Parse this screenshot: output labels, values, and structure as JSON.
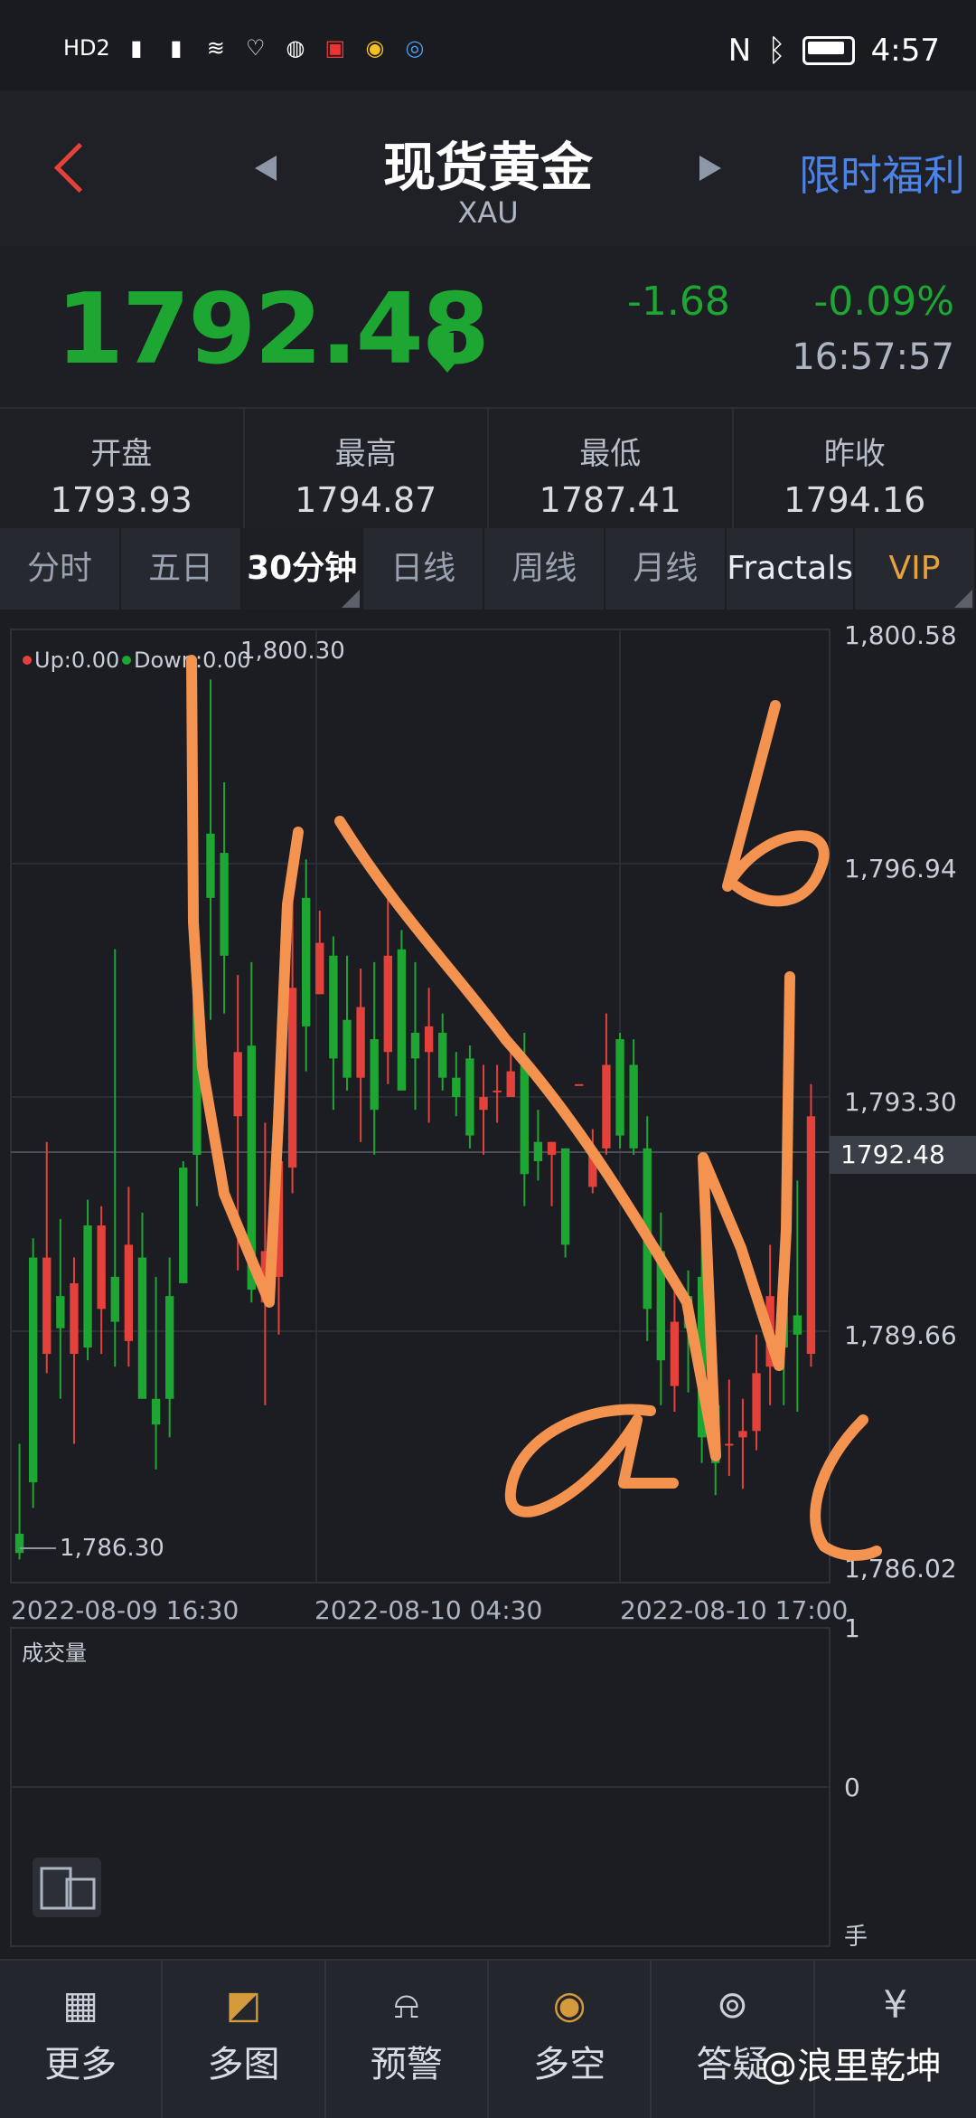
{
  "status_bar": {
    "left_icons": [
      "HD2",
      "signal-x",
      "5G-signal",
      "wifi",
      "heart",
      "ball",
      "book",
      "weibo",
      "app"
    ],
    "time": "4:57"
  },
  "header": {
    "title": "现货黄金",
    "subtitle": "XAU",
    "promo": "限时福利"
  },
  "price": {
    "current": "1792.48",
    "change": "-1.68",
    "change_pct": "-0.09%",
    "time": "16:57:57",
    "color": "#1ea632"
  },
  "stats": [
    {
      "label": "开盘",
      "value": "1793.93"
    },
    {
      "label": "最高",
      "value": "1794.87"
    },
    {
      "label": "最低",
      "value": "1787.41"
    },
    {
      "label": "昨收",
      "value": "1794.16"
    }
  ],
  "tabs": [
    "分时",
    "五日",
    "30分钟",
    "日线",
    "周线",
    "月线",
    "Fractals",
    "VIP"
  ],
  "chart": {
    "legend_up": "Up:0.00",
    "legend_down": "Down:0.00",
    "high_label": "1,800.30",
    "low_label": "1,786.30",
    "y_ticks": [
      "1,800.58",
      "1,796.94",
      "1,793.30",
      "1,789.66",
      "1,786.02"
    ],
    "current_tag": "1792.48",
    "x_ticks": [
      "2022-08-09 16:30",
      "2022-08-10 04:30",
      "2022-08-10 17:00"
    ],
    "volume_label": "成交量",
    "vol_ticks": [
      "1",
      "0"
    ],
    "vol_unit": "手"
  },
  "chart_data": {
    "type": "candlestick",
    "ylim": [
      1786.02,
      1800.58
    ],
    "candles": [
      [
        1786.5,
        1786.2,
        1787.9,
        1786.1
      ],
      [
        1790.8,
        1787.3,
        1791.1,
        1786.9
      ],
      [
        1789.3,
        1790.8,
        1792.6,
        1789.0
      ],
      [
        1790.2,
        1789.7,
        1791.4,
        1788.6
      ],
      [
        1789.3,
        1790.4,
        1790.8,
        1787.9
      ],
      [
        1791.3,
        1789.4,
        1791.7,
        1789.2
      ],
      [
        1790.0,
        1791.3,
        1791.6,
        1789.3
      ],
      [
        1790.5,
        1789.8,
        1795.6,
        1789.1
      ],
      [
        1789.5,
        1791.0,
        1791.9,
        1789.1
      ],
      [
        1790.8,
        1788.6,
        1791.5,
        1788.6
      ],
      [
        1788.6,
        1788.2,
        1790.5,
        1787.5
      ],
      [
        1790.2,
        1788.6,
        1790.8,
        1788.0
      ],
      [
        1792.2,
        1790.4,
        1792.3,
        1790.4
      ],
      [
        1795.2,
        1792.4,
        1797.5,
        1791.6
      ],
      [
        1797.4,
        1796.4,
        1799.8,
        1794.5
      ],
      [
        1797.1,
        1795.5,
        1798.2,
        1794.6
      ],
      [
        1793.0,
        1794.0,
        1795.2,
        1790.6
      ],
      [
        1794.1,
        1790.3,
        1795.4,
        1790.1
      ],
      [
        1790.1,
        1790.9,
        1792.9,
        1788.5
      ],
      [
        1790.5,
        1792.3,
        1793.6,
        1789.6
      ],
      [
        1792.2,
        1795.0,
        1796.7,
        1791.8
      ],
      [
        1796.4,
        1794.4,
        1797.0,
        1793.7
      ],
      [
        1794.9,
        1795.7,
        1796.2,
        1795.2
      ],
      [
        1795.5,
        1793.9,
        1795.8,
        1793.1
      ],
      [
        1794.5,
        1793.6,
        1795.5,
        1793.4
      ],
      [
        1793.6,
        1794.7,
        1795.3,
        1792.6
      ],
      [
        1794.2,
        1793.1,
        1795.4,
        1792.4
      ],
      [
        1794.0,
        1795.5,
        1796.6,
        1793.5
      ],
      [
        1795.6,
        1793.4,
        1795.9,
        1793.4
      ],
      [
        1794.3,
        1793.9,
        1795.4,
        1793.1
      ],
      [
        1794.0,
        1794.4,
        1795.0,
        1792.9
      ],
      [
        1794.3,
        1793.6,
        1794.6,
        1793.4
      ],
      [
        1793.6,
        1793.3,
        1794.0,
        1793.0
      ],
      [
        1793.9,
        1792.7,
        1794.1,
        1792.5
      ],
      [
        1793.1,
        1793.3,
        1793.8,
        1792.4
      ],
      [
        1793.4,
        1793.4,
        1793.8,
        1792.9
      ],
      [
        1793.3,
        1793.7,
        1794.2,
        1793.4
      ],
      [
        1793.9,
        1792.1,
        1794.3,
        1791.6
      ],
      [
        1792.6,
        1792.3,
        1793.1,
        1792.0
      ],
      [
        1792.4,
        1792.6,
        1792.6,
        1791.6
      ],
      [
        1792.5,
        1791.0,
        1792.5,
        1790.8
      ],
      [
        1793.5,
        1793.5,
        1793.5,
        1793.5
      ],
      [
        1791.9,
        1792.5,
        1792.8,
        1791.8
      ],
      [
        1792.5,
        1793.8,
        1794.6,
        1792.4
      ],
      [
        1794.2,
        1792.7,
        1794.3,
        1792.5
      ],
      [
        1793.8,
        1792.5,
        1794.2,
        1792.4
      ],
      [
        1792.5,
        1790.0,
        1793.0,
        1789.5
      ],
      [
        1790.9,
        1789.2,
        1791.5,
        1788.5
      ],
      [
        1788.8,
        1789.8,
        1790.5,
        1788.4
      ],
      [
        1790.2,
        1789.7,
        1790.6,
        1788.7
      ],
      [
        1790.5,
        1788.0,
        1791.3,
        1787.6
      ],
      [
        1788.5,
        1787.6,
        1788.7,
        1787.1
      ],
      [
        1787.9,
        1787.9,
        1788.9,
        1787.4
      ],
      [
        1788.0,
        1788.1,
        1788.6,
        1787.2
      ],
      [
        1788.1,
        1789.0,
        1789.6,
        1787.8
      ],
      [
        1789.1,
        1790.2,
        1791.0,
        1788.5
      ],
      [
        1790.3,
        1789.4,
        1791.3,
        1788.5
      ],
      [
        1789.9,
        1789.6,
        1792.0,
        1788.4
      ],
      [
        1789.3,
        1793.0,
        1793.5,
        1789.1
      ]
    ],
    "volume_ylim": [
      0,
      1
    ],
    "series": []
  },
  "nav": [
    {
      "label": "更多",
      "icon": "grid-icon"
    },
    {
      "label": "多图",
      "icon": "multi-chart-icon"
    },
    {
      "label": "预警",
      "icon": "bell-icon"
    },
    {
      "label": "多空",
      "icon": "trend-icon"
    },
    {
      "label": "答疑",
      "icon": "qa-icon"
    },
    {
      "label": "",
      "icon": "bag-icon"
    }
  ],
  "watermark": "@浪里乾坤"
}
